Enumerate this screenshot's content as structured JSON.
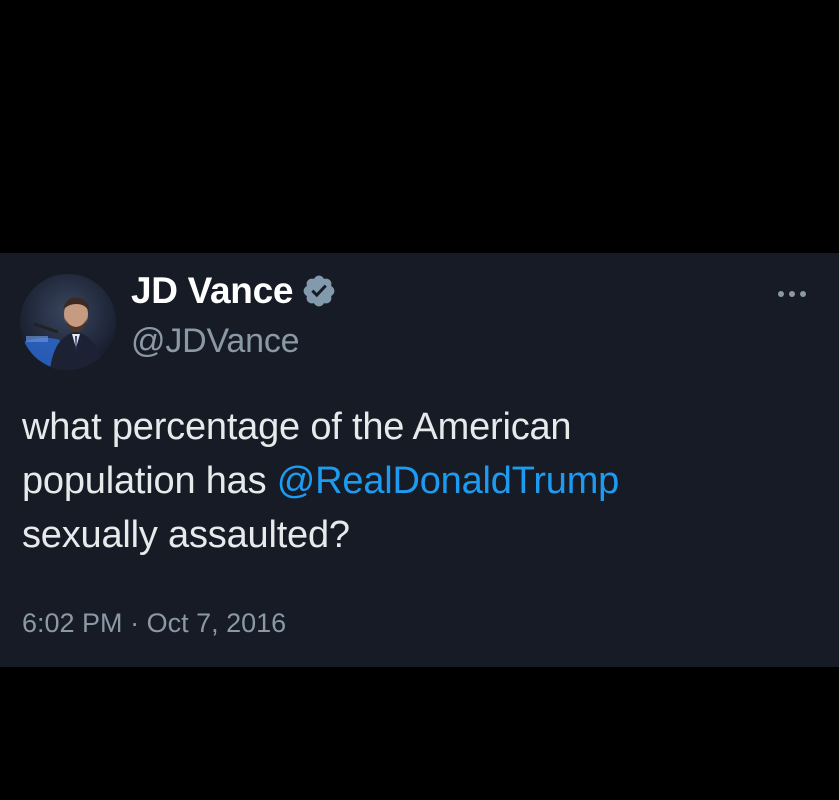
{
  "tweet": {
    "author": {
      "display_name": "JD Vance",
      "handle": "@JDVance",
      "verified": true
    },
    "text": {
      "line1": "what percentage of the American",
      "line2_prefix": "population has ",
      "mention": "@RealDonaldTrump",
      "line3": "sexually assaulted?"
    },
    "time": "6:02 PM",
    "separator": " · ",
    "date": "Oct 7, 2016",
    "icons": {
      "verified": "verified-badge-icon",
      "more": "more-options-icon"
    },
    "colors": {
      "background": "#161b26",
      "mention": "#1d9bf0",
      "secondary_text": "#8b98a5",
      "primary_text": "#e7e9ea",
      "verified_badge": "#829aab"
    }
  }
}
